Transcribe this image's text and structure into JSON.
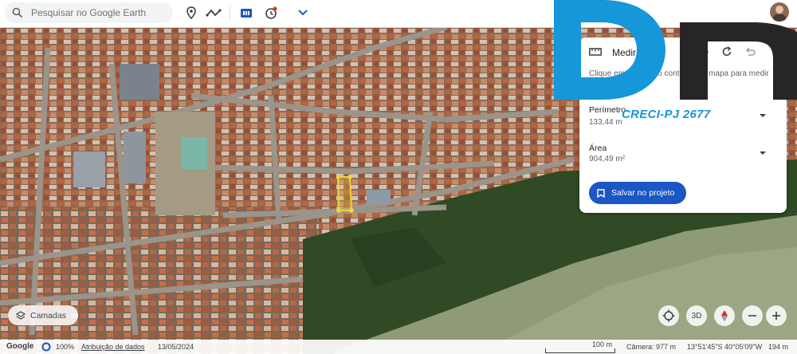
{
  "search": {
    "placeholder": "Pesquisar no Google Earth"
  },
  "toolbar": {
    "icons": [
      "pin-icon",
      "path-icon",
      "projects-icon",
      "history-icon",
      "chevron-down-icon"
    ]
  },
  "measure_panel": {
    "title": "Medir",
    "hint": "Clique em pontos no contorno do mapa para medir áreas",
    "perimeter_label": "Perímetro",
    "perimeter_value": "133,44 m",
    "area_label": "Área",
    "area_value": "904,49 m²",
    "save_label": "Salvar no projeto"
  },
  "watermark": {
    "text": "CRECI-PJ 2677",
    "logo_color": "#1597d9",
    "logo_dark": "#262626"
  },
  "layers_label": "Camadas",
  "controls": {
    "view_3d": "3D"
  },
  "footer": {
    "brand": "Google",
    "zoom": "100%",
    "attribution": "Atribuição de dados",
    "date": "13/05/2024",
    "scale": "100 m",
    "camera": "Câmera: 977 m",
    "coords": "13°51'45\"S 40°05'09\"W",
    "elevation": "194 m"
  },
  "colors": {
    "accent": "#1a56c4",
    "footprint": "#f2d23c"
  }
}
